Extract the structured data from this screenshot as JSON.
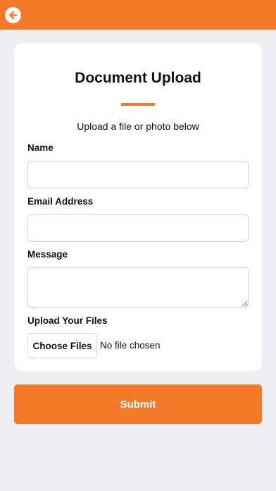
{
  "header": {
    "back_icon": "back-arrow-icon",
    "accent_color": "#f47a2a"
  },
  "form": {
    "title": "Document Upload",
    "subtitle": "Upload a file or photo below",
    "name_label": "Name",
    "name_value": "",
    "email_label": "Email Address",
    "email_value": "",
    "message_label": "Message",
    "message_value": "",
    "upload_label": "Upload Your Files",
    "choose_files_label": "Choose Files",
    "file_status": "No file chosen"
  },
  "submit_label": "Submit"
}
